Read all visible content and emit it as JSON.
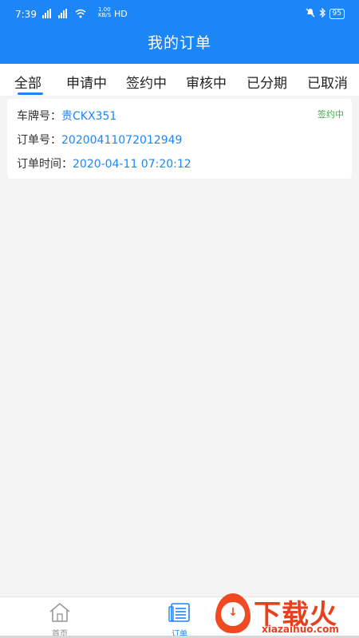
{
  "status_bar": {
    "time": "7:39",
    "signals": "4G 4G",
    "net_speed": "1.00 KB/S",
    "net_type": "HD",
    "battery": "95"
  },
  "header": {
    "title": "我的订单"
  },
  "tabs": [
    {
      "label": "全部",
      "active": true
    },
    {
      "label": "申请中",
      "active": false
    },
    {
      "label": "签约中",
      "active": false
    },
    {
      "label": "审核中",
      "active": false
    },
    {
      "label": "已分期",
      "active": false
    },
    {
      "label": "已取消",
      "active": false
    }
  ],
  "orders": [
    {
      "plate_label": "车牌号：",
      "plate_value": "贵CKX351",
      "order_no_label": "订单号：",
      "order_no_value": "20200411072012949",
      "order_time_label": "订单时间：",
      "order_time_value": "2020-04-11 07:20:12",
      "status": "签约中"
    }
  ],
  "bottom_nav": [
    {
      "label": "首页",
      "icon": "home-icon",
      "active": false
    },
    {
      "label": "订单",
      "icon": "order-icon",
      "active": true
    }
  ],
  "watermark": {
    "title": "下载火",
    "subtitle": "xiazaihuo.com"
  },
  "colors": {
    "accent": "#1c86f7",
    "status_green": "#3fae49",
    "watermark": "#e8401c"
  }
}
